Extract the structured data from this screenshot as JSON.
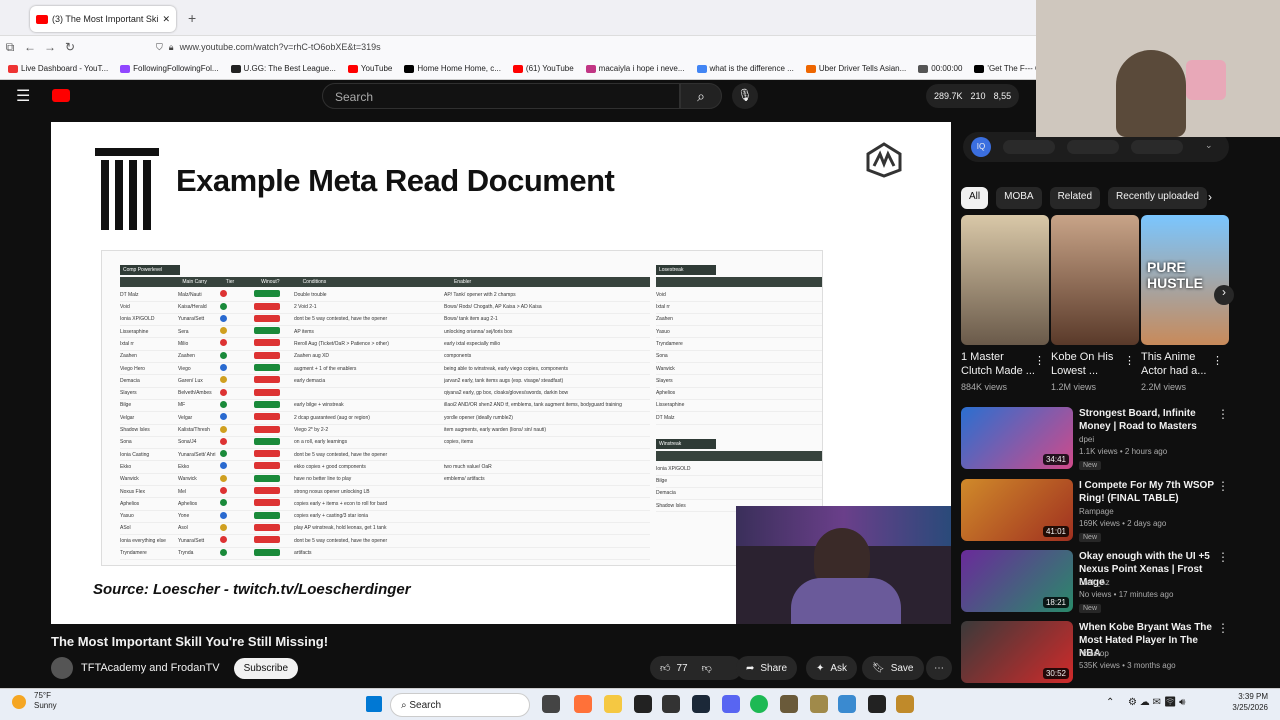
{
  "browser": {
    "tab_title": "(3) The Most Important Ski",
    "url": "www.youtube.com/watch?v=rhC-tO6obXE&t=319s",
    "bookmarks": [
      "Live Dashboard - YouT...",
      "FollowingFollowingFol...",
      "U.GG: The Best League...",
      "YouTube",
      "Home Home Home, c...",
      "(61) YouTube",
      "macaiyla i hope i neve...",
      "what is the difference ...",
      "Uber Driver Tells Asian...",
      "00:00:00",
      "'Get The F--- Out Of M"
    ]
  },
  "yt": {
    "search_placeholder": "Search",
    "stats": {
      "views": "289.7K",
      "likes": "210",
      "extra": "8,55"
    }
  },
  "video": {
    "doc_title": "Example Meta Read Document",
    "source": "Source: Loescher - twitch.tv/Loescherdinger",
    "sheet_headers": [
      "Comp Powerlevel",
      "Main Carry",
      "Tier",
      "Winout?",
      "Conditions",
      "Enabler"
    ],
    "losestreak_header": "Losestreak",
    "winstreak_header": "Winstreak",
    "rows": [
      {
        "comp": "DT Malz",
        "carry": "Malz/Nauti",
        "cond": "Double trouble",
        "enabler": "AP/ Tank/ opener with 2 champs"
      },
      {
        "comp": "Void",
        "carry": "Kaisa/Herald",
        "cond": "2 Void 2-1",
        "enabler": "Bows/ Rods/ Chogath, AP Kaisa > AD Kaisa"
      },
      {
        "comp": "Ionia XP/GOLD",
        "carry": "Yunara/Sett",
        "cond": "dont be 5 way contested, have the opener",
        "enabler": "Bows/ tank item aug 2-1"
      },
      {
        "comp": "Lisseraphine",
        "carry": "Sera",
        "cond": "AP items",
        "enabler": "unlocking orianna/ sej/loris box"
      },
      {
        "comp": "Ixtal rr",
        "carry": "Milio",
        "cond": "Reroll Aug (Ticket/OaR > Patience > other)",
        "enabler": "early ixtal especially milio"
      },
      {
        "comp": "Zaahen",
        "carry": "Zaahen",
        "cond": "Zaahen aug XD",
        "enabler": "components"
      },
      {
        "comp": "Viego Hero",
        "carry": "Viego",
        "cond": "augment + 1 of the enablers",
        "enabler": "being able to winstreak, early viego copies, components"
      },
      {
        "comp": "Demacia",
        "carry": "Garen/ Lux",
        "cond": "early demacia",
        "enabler": "jarvan2 early, tank items augs (esp. visage/ steadfast)"
      },
      {
        "comp": "Slayers",
        "carry": "Belveth/Ambes",
        "cond": "",
        "enabler": "qiyana2 early, gp box, cloaks/gloves/swords, darkin bow"
      },
      {
        "comp": "Bilge",
        "carry": "MF",
        "cond": "early bilge + winstreak",
        "enabler": "illaoi2 AND/OR shen2 AND tf, emblems, tank augment items, bodyguard training"
      },
      {
        "comp": "Velgar",
        "carry": "Velgar",
        "cond": "2 dcap guaranteed (aug or region)",
        "enabler": "yordle opener (ideally rumble2)"
      },
      {
        "comp": "Shadow Isles",
        "carry": "Kalista/Thresh",
        "cond": "Viego 2* by 2-2",
        "enabler": "item augments, early warden (lions/ sin/ nauti)"
      },
      {
        "comp": "Sona",
        "carry": "Sona/J4",
        "cond": "on a roll, early learnings",
        "enabler": "copies, items"
      },
      {
        "comp": "Ionia Casting",
        "carry": "Yunara/Sett/ Ahri",
        "cond": "dont be 5 way contested, have the opener",
        "enabler": ""
      },
      {
        "comp": "Ekko",
        "carry": "Ekko",
        "cond": "ekko copies + good components",
        "enabler": "two much value/ OaR"
      },
      {
        "comp": "Warwick",
        "carry": "Warwick",
        "cond": "have no better line to play",
        "enabler": "emblems/ artifacts"
      },
      {
        "comp": "Noxus Flex",
        "carry": "Mel",
        "cond": "strong noxus opener unlocking LB",
        "enabler": ""
      },
      {
        "comp": "Aphelios",
        "carry": "Aphelios",
        "cond": "copies early + items + econ to roll for bard",
        "enabler": ""
      },
      {
        "comp": "Yasuo",
        "carry": "Yone",
        "cond": "copies early + casting/3 star ionia",
        "enabler": ""
      },
      {
        "comp": "ASol",
        "carry": "Asol",
        "cond": "play AP winstreak, hold leonas, get 1 tank",
        "enabler": ""
      },
      {
        "comp": "Ionia everything else",
        "carry": "Yunara/Sett",
        "cond": "dont be 5 way contested, have the opener",
        "enabler": ""
      },
      {
        "comp": "Tryndamere",
        "carry": "Trynda",
        "cond": "artifacts",
        "enabler": ""
      }
    ],
    "losestreak": [
      "Void",
      "Ixtal rr",
      "Zaahen",
      "Yasuo",
      "Tryndamere",
      "Sona",
      "Warwick",
      "Slayers",
      "Aphelios",
      "Lisseraphine",
      "DT Malz"
    ],
    "winstreak": [
      "Ionia XP/GOLD",
      "Bilge",
      "Demacia",
      "Shadow Isles"
    ],
    "title": "The Most Important Skill You're Still Missing!",
    "channel": "TFTAcademy and FrodanTV",
    "subscribe": "Subscribe",
    "likes": "77",
    "share": "Share",
    "ask": "Ask",
    "save": "Save"
  },
  "sidebar": {
    "chips": [
      "All",
      "MOBA",
      "Related",
      "Recently uploaded"
    ],
    "shorts": [
      {
        "title": "1 Master Clutch Made ...",
        "views": "884K views"
      },
      {
        "title": "Kobe On His Lowest ...",
        "views": "1.2M views"
      },
      {
        "title": "This Anime Actor had a...",
        "views": "2.2M views"
      }
    ],
    "recs": [
      {
        "title": "Strongest Board, Infinite Money | Road to Masters",
        "channel": "dpei",
        "meta": "1.1K views • 2 hours ago",
        "badge": "New",
        "dur": "34:41"
      },
      {
        "title": "I Compete For My 7th WSOP Ring! (FINAL TABLE)",
        "channel": "Rampage",
        "meta": "169K views • 2 days ago",
        "badge": "New",
        "dur": "41:01"
      },
      {
        "title": "Okay enough with the UI +5 Nexus Point Xenas | Frost Mage",
        "channel": "Luck_Az",
        "meta": "No views • 17 minutes ago",
        "badge": "New",
        "dur": "18:21"
      },
      {
        "title": "When Kobe Bryant Was The Most Hated Player In The NBA",
        "channel": "Nonstop",
        "meta": "535K views • 3 months ago",
        "badge": "",
        "dur": "30:52"
      }
    ]
  },
  "taskbar": {
    "temp": "75°F",
    "weather": "Sunny",
    "search": "Search",
    "time": "3:39 PM",
    "date": "3/25/2026"
  }
}
